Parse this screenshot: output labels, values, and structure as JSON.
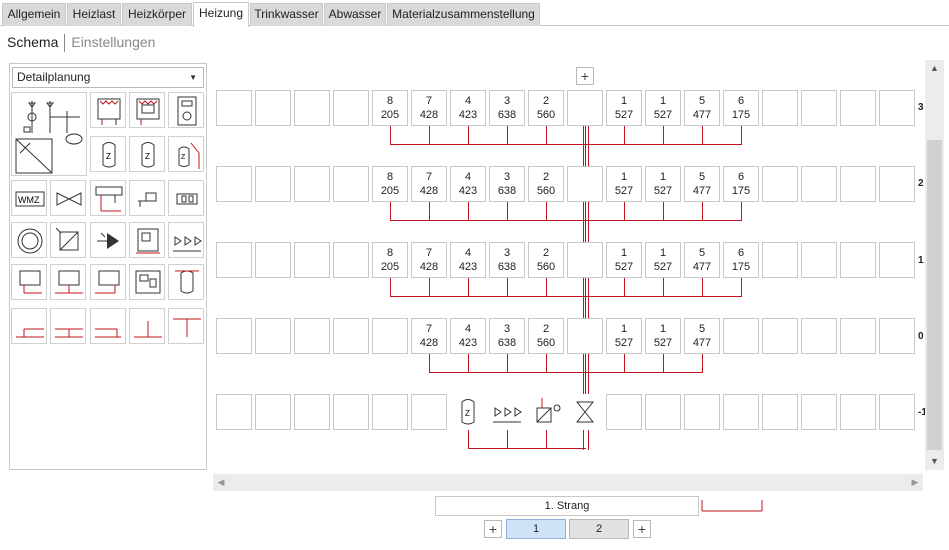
{
  "tabs": [
    {
      "label": "Allgemein",
      "active": false
    },
    {
      "label": "Heizlast",
      "active": false
    },
    {
      "label": "Heizkörper",
      "active": false
    },
    {
      "label": "Heizung",
      "active": true
    },
    {
      "label": "Trinkwasser",
      "active": false
    },
    {
      "label": "Abwasser",
      "active": false
    },
    {
      "label": "Materialzusammenstellung",
      "active": false
    }
  ],
  "subnav": {
    "schema": "Schema",
    "settings": "Einstellungen"
  },
  "left_panel": {
    "dropdown_value": "Detailplanung",
    "tools": [
      {
        "name": "heating-system-overview-icon"
      },
      {
        "name": "radiator-icon"
      },
      {
        "name": "radiator-control-icon"
      },
      {
        "name": "boiler-control-icon"
      },
      {
        "name": "heat-exchanger-icon"
      },
      {
        "name": "storage-tank-icon"
      },
      {
        "name": "storage-tank-2-icon"
      },
      {
        "name": "solar-tank-icon"
      },
      {
        "name": "wmz-meter-icon",
        "text": "WMZ"
      },
      {
        "name": "valve-icon"
      },
      {
        "name": "distributor-icon"
      },
      {
        "name": "pump-connector-icon"
      },
      {
        "name": "fitting-icon"
      },
      {
        "name": "circle-pump-icon"
      },
      {
        "name": "mixer-valve-icon"
      },
      {
        "name": "pump-icon"
      },
      {
        "name": "control-unit-icon"
      },
      {
        "name": "valve-group-icon"
      },
      {
        "name": "radiator-down-icon"
      },
      {
        "name": "radiator-tee-icon"
      },
      {
        "name": "radiator-right-icon"
      },
      {
        "name": "control-panel-icon"
      },
      {
        "name": "tank-small-icon"
      },
      {
        "name": "pipe-left-icon"
      },
      {
        "name": "pipe-double-icon"
      },
      {
        "name": "pipe-right-icon"
      },
      {
        "name": "pipe-tee-up-icon"
      },
      {
        "name": "pipe-tee-down-icon"
      }
    ]
  },
  "floors": [
    {
      "label": "3",
      "cells": [
        {
          "top": "8",
          "bottom": "205"
        },
        {
          "top": "7",
          "bottom": "428"
        },
        {
          "top": "4",
          "bottom": "423"
        },
        {
          "top": "3",
          "bottom": "638"
        },
        {
          "top": "2",
          "bottom": "560"
        },
        {
          "top": "1",
          "bottom": "527"
        },
        {
          "top": "1",
          "bottom": "527"
        },
        {
          "top": "5",
          "bottom": "477"
        },
        {
          "top": "6",
          "bottom": "175"
        }
      ]
    },
    {
      "label": "2",
      "cells": [
        {
          "top": "8",
          "bottom": "205"
        },
        {
          "top": "7",
          "bottom": "428"
        },
        {
          "top": "4",
          "bottom": "423"
        },
        {
          "top": "3",
          "bottom": "638"
        },
        {
          "top": "2",
          "bottom": "560"
        },
        {
          "top": "1",
          "bottom": "527"
        },
        {
          "top": "1",
          "bottom": "527"
        },
        {
          "top": "5",
          "bottom": "477"
        },
        {
          "top": "6",
          "bottom": "175"
        }
      ]
    },
    {
      "label": "1",
      "cells": [
        {
          "top": "8",
          "bottom": "205"
        },
        {
          "top": "7",
          "bottom": "428"
        },
        {
          "top": "4",
          "bottom": "423"
        },
        {
          "top": "3",
          "bottom": "638"
        },
        {
          "top": "2",
          "bottom": "560"
        },
        {
          "top": "1",
          "bottom": "527"
        },
        {
          "top": "1",
          "bottom": "527"
        },
        {
          "top": "5",
          "bottom": "477"
        },
        {
          "top": "6",
          "bottom": "175"
        }
      ]
    },
    {
      "label": "0",
      "cells": [
        {
          "top": "7",
          "bottom": "428"
        },
        {
          "top": "4",
          "bottom": "423"
        },
        {
          "top": "3",
          "bottom": "638"
        },
        {
          "top": "2",
          "bottom": "560"
        },
        {
          "top": "1",
          "bottom": "527"
        },
        {
          "top": "1",
          "bottom": "527"
        },
        {
          "top": "5",
          "bottom": "477"
        }
      ]
    },
    {
      "label": "-1"
    }
  ],
  "bottom": {
    "strang_label": "1. Strang",
    "pages": [
      "1",
      "2"
    ],
    "add_symbol": "+"
  },
  "colors": {
    "pipe_red": "#c0141e",
    "pipe_blue": "#1e3c96",
    "active_page": "#cfe3f7"
  }
}
